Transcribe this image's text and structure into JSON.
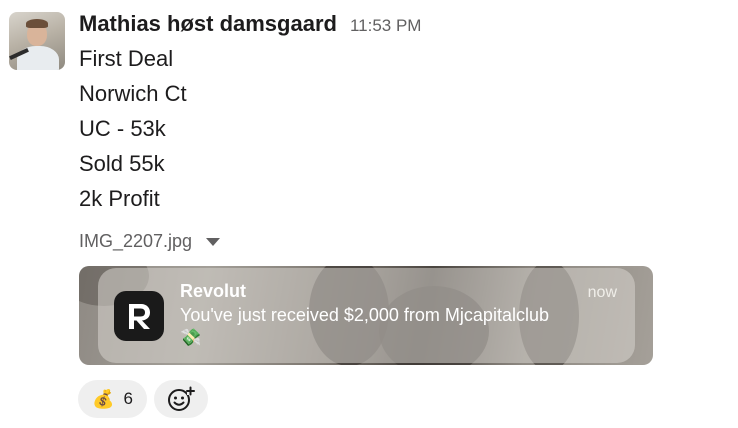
{
  "message": {
    "sender": "Mathias høst damsgaard",
    "timestamp": "11:53 PM",
    "lines": [
      "First Deal",
      "Norwich Ct",
      "UC - 53k",
      "Sold 55k",
      "2k Profit"
    ],
    "attachment": {
      "file_name": "IMG_2207.jpg",
      "notification": {
        "app_name": "Revolut",
        "time": "now",
        "text": "You've just received $2,000 from Mjcapitalclub",
        "emoji": "💸"
      }
    },
    "reactions": [
      {
        "emoji": "💰",
        "count": "6"
      }
    ]
  },
  "icons": {
    "avatar": "user-avatar",
    "dropdown": "chevron-down-icon",
    "add_reaction": "add-reaction-icon",
    "app_icon": "revolut-logo"
  },
  "colors": {
    "text": "#1d1c1d",
    "muted": "#616061",
    "reaction_bg": "#efefef"
  }
}
